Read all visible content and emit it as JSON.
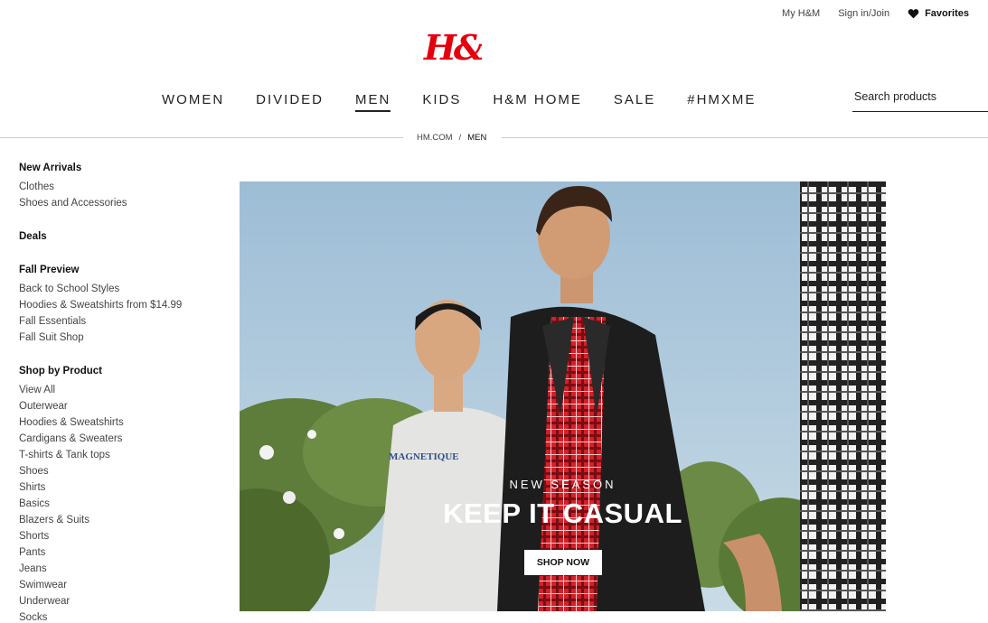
{
  "utility": {
    "my_hm": "My H&M",
    "sign_in": "Sign in/Join",
    "favorites": "Favorites"
  },
  "brand": {
    "logo": "H&M",
    "logo_color": "#e50010"
  },
  "nav": {
    "items": [
      "WOMEN",
      "DIVIDED",
      "MEN",
      "KIDS",
      "H&M HOME",
      "SALE",
      "#HMXME"
    ],
    "active": "MEN"
  },
  "search": {
    "placeholder": "Search products"
  },
  "breadcrumb": {
    "home": "HM.COM",
    "separator": "/",
    "current": "MEN"
  },
  "sidebar": {
    "new_arrivals": {
      "heading": "New Arrivals",
      "links": [
        "Clothes",
        "Shoes and Accessories"
      ]
    },
    "deals": {
      "heading": "Deals"
    },
    "fall_preview": {
      "heading": "Fall Preview",
      "links": [
        "Back to School Styles",
        "Hoodies & Sweatshirts from $14.99",
        "Fall Essentials",
        "Fall Suit Shop"
      ]
    },
    "shop_by_product": {
      "heading": "Shop by Product",
      "links": [
        "View All",
        "Outerwear",
        "Hoodies & Sweatshirts",
        "Cardigans & Sweaters",
        "T-shirts & Tank tops",
        "Shoes",
        "Shirts",
        "Basics",
        "Blazers & Suits",
        "Shorts",
        "Pants",
        "Jeans",
        "Swimwear",
        "Underwear",
        "Socks"
      ]
    }
  },
  "hero": {
    "kicker": "NEW SEASON",
    "headline": "KEEP IT CASUAL",
    "cta": "SHOP NOW",
    "sweatshirt_print": "MAGNETIQUE"
  }
}
